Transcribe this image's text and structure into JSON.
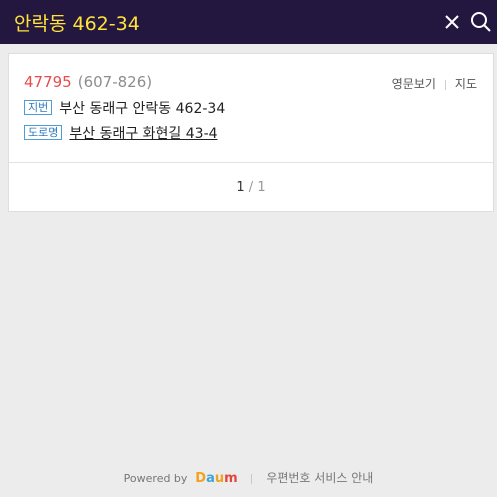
{
  "header": {
    "search_query": "안락동 462-34",
    "close_icon": "close-icon",
    "search_icon": "search-icon"
  },
  "result": {
    "zipcode_new": "47795",
    "zipcode_old": "(607-826)",
    "english_link": "영문보기",
    "map_link": "지도",
    "jibun_tag": "지번",
    "jibun_address": "부산 동래구 안락동 462-34",
    "road_tag": "도로명",
    "road_address": "부산 동래구 화현길 43-4"
  },
  "pager": {
    "current": "1",
    "separator": "/",
    "total": "1"
  },
  "footer": {
    "powered_by": "Powered by",
    "logo_parts": [
      "D",
      "a",
      "u",
      "m"
    ],
    "service_link": "우편번호 서비스 안내"
  },
  "colors": {
    "header_bg": "#24173f",
    "query_text": "#ffe33a",
    "zipcode_new": "#e84c4c",
    "tag_blue": "#2f7bbf"
  }
}
